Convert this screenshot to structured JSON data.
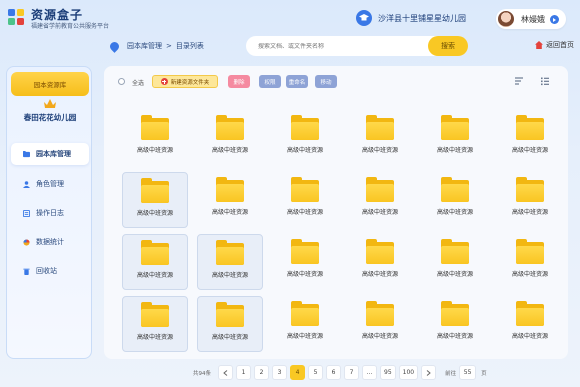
{
  "header": {
    "title": "资源盒子",
    "subtitle": "福建省学前教育公共服务平台",
    "school": "沙洋县十里铺星星幼儿园",
    "user_name": "林嫚娥"
  },
  "breadcrumb": [
    "园本库管理",
    ">",
    "目录列表"
  ],
  "search": {
    "placeholder": "搜索文档、或文件夹名称",
    "button": "搜索"
  },
  "home_link": "返回首页",
  "sidebar": {
    "tag": "园本资源库",
    "school": "春田花花幼儿园",
    "items": [
      {
        "label": "园本库管理",
        "icon": "folder-icon",
        "active": true
      },
      {
        "label": "角色管理",
        "icon": "user-icon",
        "active": false
      },
      {
        "label": "操作日志",
        "icon": "log-icon",
        "active": false
      },
      {
        "label": "数据统计",
        "icon": "chart-icon",
        "active": false
      },
      {
        "label": "回收站",
        "icon": "trash-icon",
        "active": false
      }
    ]
  },
  "toolbar": {
    "select_all": "全选",
    "new_folder": "新建资源文件夹",
    "delete": "删除",
    "permission": "权限",
    "rename": "重命名",
    "move": "移动"
  },
  "colors": {
    "accent": "#f9c824",
    "primary": "#3a78e6",
    "folder": "#f9c522",
    "danger": "#e3423c"
  },
  "folders": [
    {
      "label": "高级中班资源",
      "selected": false
    },
    {
      "label": "高级中班资源",
      "selected": false
    },
    {
      "label": "高级中班资源",
      "selected": false
    },
    {
      "label": "高级中班资源",
      "selected": false
    },
    {
      "label": "高级中班资源",
      "selected": false
    },
    {
      "label": "高级中班资源",
      "selected": false
    },
    {
      "label": "高级中班资源",
      "selected": true
    },
    {
      "label": "高级中班资源",
      "selected": false
    },
    {
      "label": "高级中班资源",
      "selected": false
    },
    {
      "label": "高级中班资源",
      "selected": false
    },
    {
      "label": "高级中班资源",
      "selected": false
    },
    {
      "label": "高级中班资源",
      "selected": false
    },
    {
      "label": "高级中班资源",
      "selected": true
    },
    {
      "label": "高级中班资源",
      "selected": true
    },
    {
      "label": "高级中班资源",
      "selected": false
    },
    {
      "label": "高级中班资源",
      "selected": false
    },
    {
      "label": "高级中班资源",
      "selected": false
    },
    {
      "label": "高级中班资源",
      "selected": false
    },
    {
      "label": "高级中班资源",
      "selected": true
    },
    {
      "label": "高级中班资源",
      "selected": true
    },
    {
      "label": "高级中班资源",
      "selected": false
    },
    {
      "label": "高级中班资源",
      "selected": false
    },
    {
      "label": "高级中班资源",
      "selected": false
    },
    {
      "label": "高级中班资源",
      "selected": false
    }
  ],
  "pagination": {
    "total": "共94条",
    "pages": [
      "1",
      "2",
      "3",
      "4",
      "5",
      "6",
      "7",
      "...",
      "95",
      "100"
    ],
    "current": "4",
    "jump_label": "前往",
    "jump_value": "55",
    "jump_suffix": "页"
  }
}
